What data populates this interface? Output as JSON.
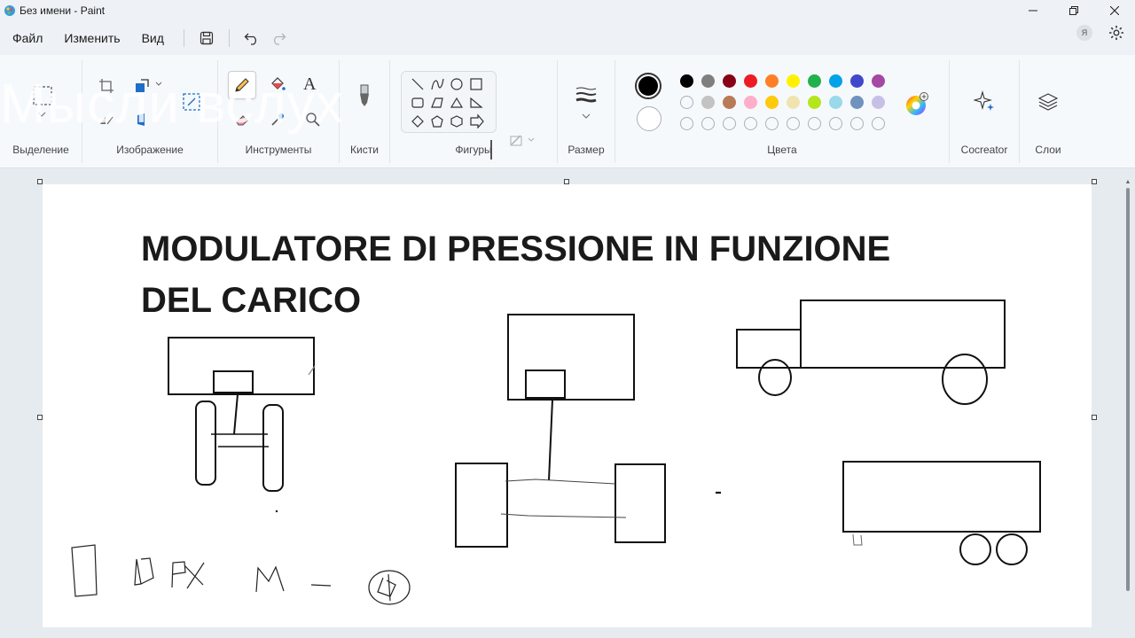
{
  "window": {
    "title": "Без имени - Paint"
  },
  "menu": {
    "file": "Файл",
    "edit": "Изменить",
    "view": "Вид"
  },
  "user": {
    "initial": "Я"
  },
  "ribbon": {
    "selection": "Выделение",
    "image": "Изображение",
    "tools": "Инструменты",
    "brushes": "Кисти",
    "shapes": "Фигуры",
    "size": "Размер",
    "colors": "Цвета",
    "cocreator": "Cocreator",
    "layers": "Слои"
  },
  "watermark": "Мысли вслух",
  "palette": {
    "primary": "#000000",
    "secondary": "#ffffff",
    "row1": [
      "#000000",
      "#7f7f7f",
      "#880015",
      "#ed1c24",
      "#ff7f27",
      "#fff200",
      "#22b14c",
      "#00a2e8",
      "#3f48cc",
      "#a349a4"
    ],
    "row2": [
      "empty",
      "#c3c3c3",
      "#b97a57",
      "#ffaec9",
      "#ffc90e",
      "#efe4b0",
      "#b5e61d",
      "#99d9ea",
      "#7092be",
      "#c8bfe7"
    ],
    "row3": [
      "empty",
      "empty",
      "empty",
      "empty",
      "empty",
      "empty",
      "empty",
      "empty",
      "empty",
      "empty"
    ]
  },
  "canvas": {
    "title_line1": "MODULATORE DI PRESSIONE IN FUNZIONE",
    "title_line2": "DEL CARICO"
  }
}
